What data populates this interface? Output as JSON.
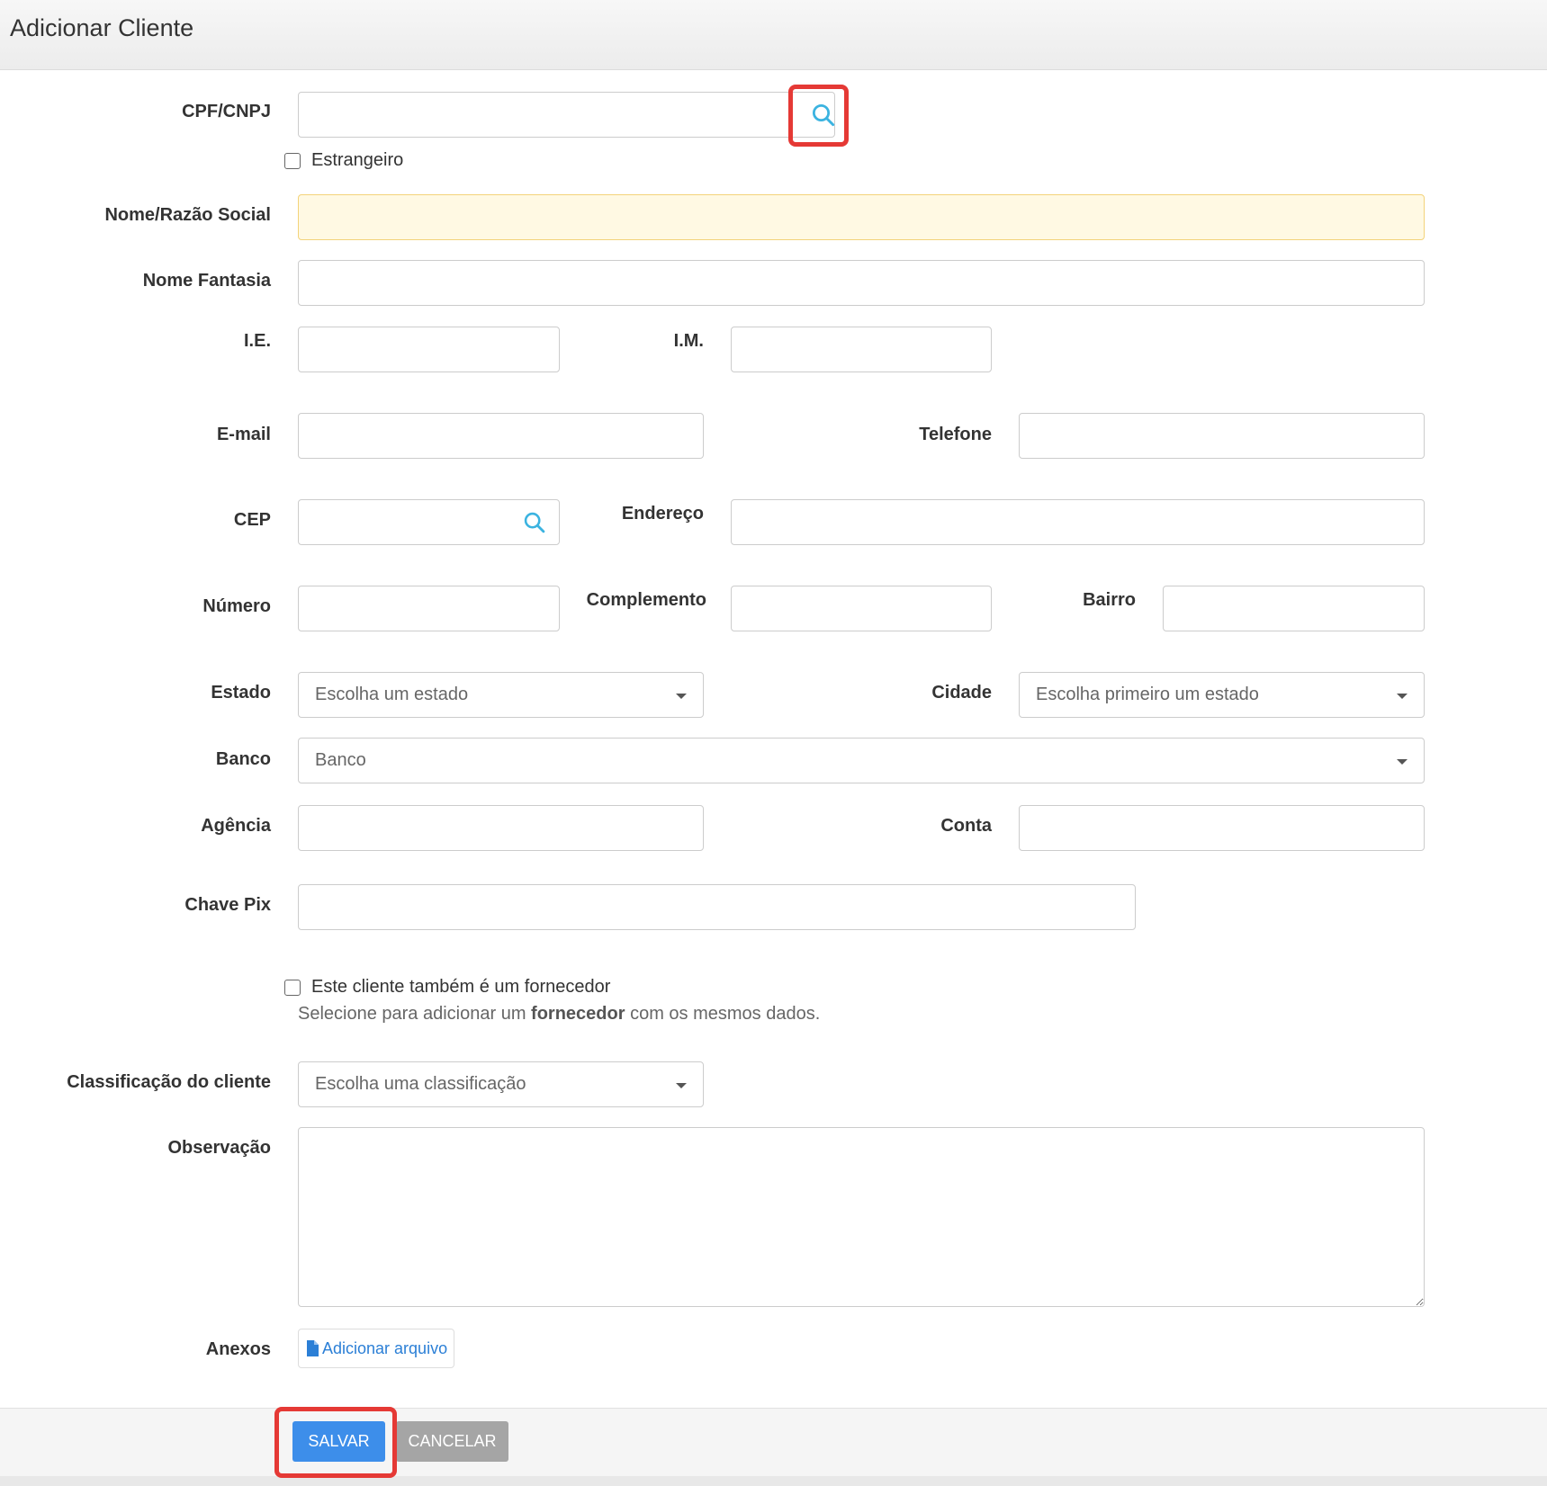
{
  "header": {
    "title": "Adicionar Cliente"
  },
  "form": {
    "cpf_cnpj": {
      "label": "CPF/CNPJ",
      "value": ""
    },
    "estrangeiro": {
      "label": "Estrangeiro",
      "checked": false
    },
    "nome_razao": {
      "label": "Nome/Razão Social",
      "value": ""
    },
    "nome_fantasia": {
      "label": "Nome Fantasia",
      "value": ""
    },
    "ie": {
      "label": "I.E.",
      "value": ""
    },
    "im": {
      "label": "I.M.",
      "value": ""
    },
    "email": {
      "label": "E-mail",
      "value": ""
    },
    "telefone": {
      "label": "Telefone",
      "value": ""
    },
    "cep": {
      "label": "CEP",
      "value": ""
    },
    "endereco": {
      "label": "Endereço",
      "value": ""
    },
    "numero": {
      "label": "Número",
      "value": ""
    },
    "complemento": {
      "label": "Complemento",
      "value": ""
    },
    "bairro": {
      "label": "Bairro",
      "value": ""
    },
    "estado": {
      "label": "Estado",
      "selected": "Escolha um estado"
    },
    "cidade": {
      "label": "Cidade",
      "selected": "Escolha primeiro um estado"
    },
    "banco": {
      "label": "Banco",
      "selected": "Banco"
    },
    "agencia": {
      "label": "Agência",
      "value": ""
    },
    "conta": {
      "label": "Conta",
      "value": ""
    },
    "chave_pix": {
      "label": "Chave Pix",
      "value": ""
    },
    "fornecedor": {
      "label": "Este cliente também é um fornecedor",
      "checked": false,
      "hint_prefix": "Selecione para adicionar um ",
      "hint_bold": "fornecedor",
      "hint_suffix": " com os mesmos dados."
    },
    "classificacao": {
      "label": "Classificação do cliente",
      "selected": "Escolha uma classificação"
    },
    "observacao": {
      "label": "Observação",
      "value": ""
    },
    "anexos": {
      "label": "Anexos",
      "button": "Adicionar arquivo"
    }
  },
  "footer": {
    "save_label": "SALVAR",
    "cancel_label": "CANCELAR"
  },
  "colors": {
    "primary": "#3d8eea",
    "secondary": "#a5a5a5",
    "highlight": "#e53935",
    "search_icon": "#3bb3e0"
  },
  "icons": {
    "search": "search-icon",
    "file": "file-icon",
    "caret": "chevron-down-icon"
  }
}
